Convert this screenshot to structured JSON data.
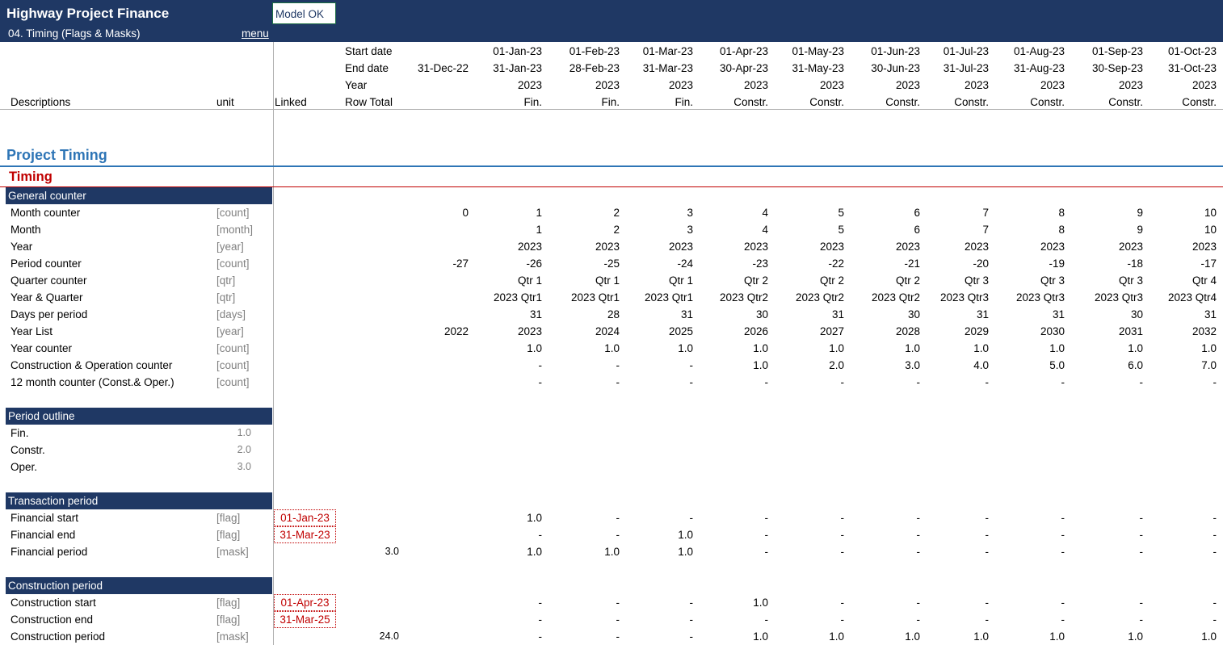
{
  "app": {
    "title": "Highway Project Finance",
    "sheet": "04. Timing (Flags & Masks)",
    "menu": "menu",
    "status": "Model OK"
  },
  "colors": {
    "header": "#1f3864",
    "section_title": "#2e75b6",
    "subsection": "#c00000"
  },
  "top_labels": {
    "start_date": "Start date",
    "end_date": "End date",
    "year": "Year",
    "row_total": "Row Total",
    "descriptions": "Descriptions",
    "unit": "unit",
    "linked": "Linked",
    "base_end_date": "31-Dec-22"
  },
  "periods": [
    {
      "start": "01-Jan-23",
      "end": "31-Jan-23",
      "year": "2023",
      "phase": "Fin."
    },
    {
      "start": "01-Feb-23",
      "end": "28-Feb-23",
      "year": "2023",
      "phase": "Fin."
    },
    {
      "start": "01-Mar-23",
      "end": "31-Mar-23",
      "year": "2023",
      "phase": "Fin."
    },
    {
      "start": "01-Apr-23",
      "end": "30-Apr-23",
      "year": "2023",
      "phase": "Constr."
    },
    {
      "start": "01-May-23",
      "end": "31-May-23",
      "year": "2023",
      "phase": "Constr."
    },
    {
      "start": "01-Jun-23",
      "end": "30-Jun-23",
      "year": "2023",
      "phase": "Constr."
    },
    {
      "start": "01-Jul-23",
      "end": "31-Jul-23",
      "year": "2023",
      "phase": "Constr."
    },
    {
      "start": "01-Aug-23",
      "end": "31-Aug-23",
      "year": "2023",
      "phase": "Constr."
    },
    {
      "start": "01-Sep-23",
      "end": "30-Sep-23",
      "year": "2023",
      "phase": "Constr."
    },
    {
      "start": "01-Oct-23",
      "end": "31-Oct-23",
      "year": "2023",
      "phase": "Constr."
    }
  ],
  "section_title": "Project Timing",
  "subsection_title": "Timing",
  "groups": [
    {
      "title": "General counter",
      "rows": [
        {
          "label": "Month counter",
          "unit": "[count]",
          "linked": "",
          "total": "",
          "base": "0",
          "values": [
            "1",
            "2",
            "3",
            "4",
            "5",
            "6",
            "7",
            "8",
            "9",
            "10"
          ]
        },
        {
          "label": "Month",
          "unit": "[month]",
          "linked": "",
          "total": "",
          "base": "",
          "values": [
            "1",
            "2",
            "3",
            "4",
            "5",
            "6",
            "7",
            "8",
            "9",
            "10"
          ]
        },
        {
          "label": "Year",
          "unit": "[year]",
          "linked": "",
          "total": "",
          "base": "",
          "values": [
            "2023",
            "2023",
            "2023",
            "2023",
            "2023",
            "2023",
            "2023",
            "2023",
            "2023",
            "2023"
          ]
        },
        {
          "label": "Period counter",
          "unit": "[count]",
          "linked": "",
          "total": "",
          "base": "-27",
          "values": [
            "-26",
            "-25",
            "-24",
            "-23",
            "-22",
            "-21",
            "-20",
            "-19",
            "-18",
            "-17"
          ]
        },
        {
          "label": "Quarter counter",
          "unit": "[qtr]",
          "linked": "",
          "total": "",
          "base": "",
          "values": [
            "Qtr 1",
            "Qtr 1",
            "Qtr 1",
            "Qtr 2",
            "Qtr 2",
            "Qtr 2",
            "Qtr 3",
            "Qtr 3",
            "Qtr 3",
            "Qtr 4"
          ]
        },
        {
          "label": "Year & Quarter",
          "unit": "[qtr]",
          "linked": "",
          "total": "",
          "base": "",
          "values": [
            "2023 Qtr1",
            "2023 Qtr1",
            "2023 Qtr1",
            "2023 Qtr2",
            "2023 Qtr2",
            "2023 Qtr2",
            "2023 Qtr3",
            "2023 Qtr3",
            "2023 Qtr3",
            "2023 Qtr4"
          ]
        },
        {
          "label": "Days per period",
          "unit": "[days]",
          "linked": "",
          "total": "",
          "base": "",
          "values": [
            "31",
            "28",
            "31",
            "30",
            "31",
            "30",
            "31",
            "31",
            "30",
            "31"
          ]
        },
        {
          "label": "Year List",
          "unit": "[year]",
          "linked": "",
          "total": "",
          "base": "2022",
          "values": [
            "2023",
            "2024",
            "2025",
            "2026",
            "2027",
            "2028",
            "2029",
            "2030",
            "2031",
            "2032"
          ]
        },
        {
          "label": "Year counter",
          "unit": "[count]",
          "linked": "",
          "total": "",
          "base": "",
          "values": [
            "1.0",
            "1.0",
            "1.0",
            "1.0",
            "1.0",
            "1.0",
            "1.0",
            "1.0",
            "1.0",
            "1.0"
          ]
        },
        {
          "label": "Construction & Operation counter",
          "unit": "[count]",
          "linked": "",
          "total": "",
          "base": "",
          "values": [
            "-",
            "-",
            "-",
            "1.0",
            "2.0",
            "3.0",
            "4.0",
            "5.0",
            "6.0",
            "7.0"
          ]
        },
        {
          "label": "12 month counter (Const.& Oper.)",
          "unit": "[count]",
          "linked": "",
          "total": "",
          "base": "",
          "values": [
            "-",
            "-",
            "-",
            "-",
            "-",
            "-",
            "-",
            "-",
            "-",
            "-"
          ]
        }
      ]
    },
    {
      "title": "Period outline",
      "rows": [
        {
          "label": "Fin.",
          "unit": "1.0",
          "linked": "",
          "total": "",
          "base": "",
          "values": [
            "",
            "",
            "",
            "",
            "",
            "",
            "",
            "",
            "",
            ""
          ]
        },
        {
          "label": "Constr.",
          "unit": "2.0",
          "linked": "",
          "total": "",
          "base": "",
          "values": [
            "",
            "",
            "",
            "",
            "",
            "",
            "",
            "",
            "",
            ""
          ]
        },
        {
          "label": "Oper.",
          "unit": "3.0",
          "linked": "",
          "total": "",
          "base": "",
          "values": [
            "",
            "",
            "",
            "",
            "",
            "",
            "",
            "",
            "",
            ""
          ]
        }
      ]
    },
    {
      "title": "Transaction period",
      "rows": [
        {
          "label": "Financial start",
          "unit": "[flag]",
          "linked": "01-Jan-23",
          "total": "",
          "base": "",
          "values": [
            "1.0",
            "-",
            "-",
            "-",
            "-",
            "-",
            "-",
            "-",
            "-",
            "-"
          ]
        },
        {
          "label": "Financial end",
          "unit": "[flag]",
          "linked": "31-Mar-23",
          "total": "",
          "base": "",
          "values": [
            "-",
            "-",
            "1.0",
            "-",
            "-",
            "-",
            "-",
            "-",
            "-",
            "-"
          ]
        },
        {
          "label": "Financial period",
          "unit": "[mask]",
          "linked": "",
          "total": "3.0",
          "base": "",
          "values": [
            "1.0",
            "1.0",
            "1.0",
            "-",
            "-",
            "-",
            "-",
            "-",
            "-",
            "-"
          ]
        }
      ]
    },
    {
      "title": "Construction period",
      "rows": [
        {
          "label": "Construction start",
          "unit": "[flag]",
          "linked": "01-Apr-23",
          "total": "",
          "base": "",
          "values": [
            "-",
            "-",
            "-",
            "1.0",
            "-",
            "-",
            "-",
            "-",
            "-",
            "-"
          ]
        },
        {
          "label": "Construction end",
          "unit": "[flag]",
          "linked": "31-Mar-25",
          "total": "",
          "base": "",
          "values": [
            "-",
            "-",
            "-",
            "-",
            "-",
            "-",
            "-",
            "-",
            "-",
            "-"
          ]
        },
        {
          "label": "Construction period",
          "unit": "[mask]",
          "linked": "",
          "total": "24.0",
          "base": "",
          "values": [
            "-",
            "-",
            "-",
            "1.0",
            "1.0",
            "1.0",
            "1.0",
            "1.0",
            "1.0",
            "1.0"
          ]
        }
      ]
    }
  ]
}
